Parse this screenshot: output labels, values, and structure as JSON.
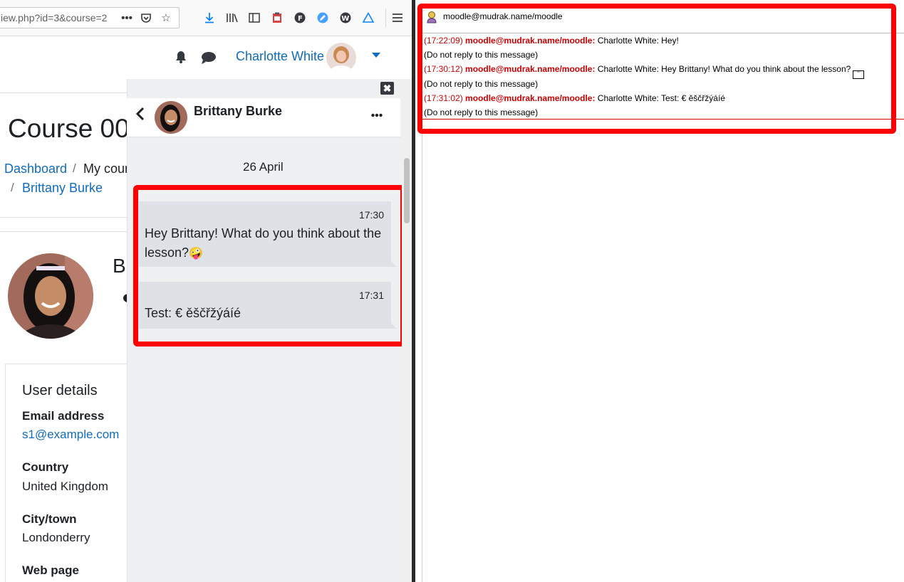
{
  "browser": {
    "url": "iew.php?id=3&course=2",
    "url_more": "•••"
  },
  "navbar": {
    "username": "Charlotte White"
  },
  "page": {
    "course_title": "Course 00",
    "breadcrumb": {
      "dashboard": "Dashboard",
      "sep": "/",
      "my_courses": "My cour",
      "user": "Brittany Burke"
    },
    "profile_initial": "B",
    "user_details": {
      "heading": "User details",
      "email_label": "Email address",
      "email_value": "s1@example.com",
      "country_label": "Country",
      "country_value": "United Kingdom",
      "city_label": "City/town",
      "city_value": "Londonderry",
      "webpage_label": "Web page"
    }
  },
  "drawer": {
    "close_symbol": "✖",
    "contact_name": "Brittany Burke",
    "date": "26 April",
    "messages": [
      {
        "time": "17:30",
        "text_line1": "Hey Brittany! What do you think about the",
        "text_line2": "lesson?",
        "emoji": "🤪"
      },
      {
        "time": "17:31",
        "text": "Test: € ěščřžýáíé"
      }
    ]
  },
  "im": {
    "title": "moodle@mudrak.name/moodle",
    "lines": [
      {
        "time": "(17:22:09)",
        "sender": "moodle@mudrak.name/moodle:",
        "text": "Charlotte White: Hey!"
      },
      {
        "note": "(Do not reply to this message)"
      },
      {
        "time": "(17:30:12)",
        "sender": "moodle@mudrak.name/moodle:",
        "text": "Charlotte White: Hey Brittany! What do you think about the lesson?"
      },
      {
        "note": "(Do not reply to this message)"
      },
      {
        "time": "(17:31:02)",
        "sender": "moodle@mudrak.name/moodle:",
        "text": "Charlotte White: Test: € ěščřžýáíé"
      },
      {
        "note": "(Do not reply to this message)"
      }
    ]
  },
  "colors": {
    "link": "#0f6cbf",
    "highlight": "#ff0000",
    "im_sender": "#cc0000",
    "bubble": "#dee2e6"
  }
}
